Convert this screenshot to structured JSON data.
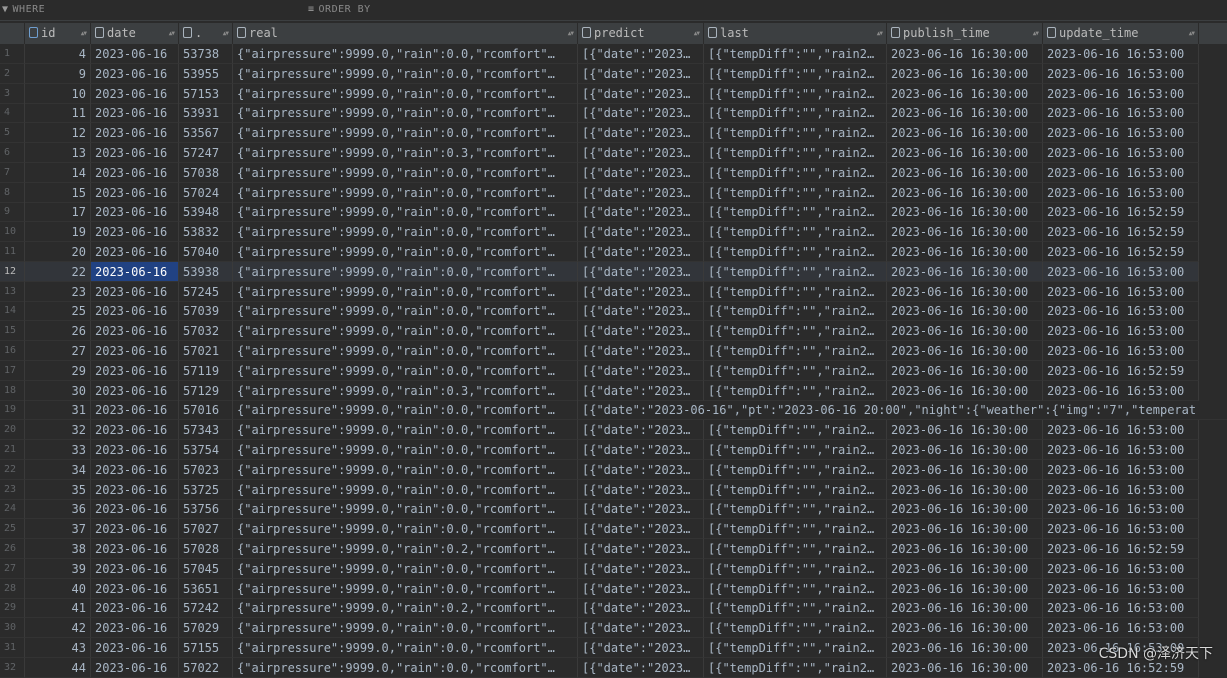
{
  "filter": {
    "where_label": "WHERE",
    "order_label": "ORDER BY"
  },
  "columns": [
    {
      "label": "id"
    },
    {
      "label": "date"
    },
    {
      "label": "."
    },
    {
      "label": "real"
    },
    {
      "label": "predict"
    },
    {
      "label": "last"
    },
    {
      "label": "publish_time"
    },
    {
      "label": "update_time"
    }
  ],
  "rows": [
    {
      "n": "1",
      "id": "4",
      "date": "2023-06-16",
      "code": "53738",
      "real": "{\"airpressure\":9999.0,\"rain\":0.0,\"rcomfort\"…",
      "predict": "[{\"date\":\"2023…",
      "last": "[{\"tempDiff\":\"\",\"rain2…",
      "pub": "2023-06-16 16:30:00",
      "upd": "2023-06-16 16:53:00"
    },
    {
      "n": "2",
      "id": "9",
      "date": "2023-06-16",
      "code": "53955",
      "real": "{\"airpressure\":9999.0,\"rain\":0.0,\"rcomfort\"…",
      "predict": "[{\"date\":\"2023…",
      "last": "[{\"tempDiff\":\"\",\"rain2…",
      "pub": "2023-06-16 16:30:00",
      "upd": "2023-06-16 16:53:00"
    },
    {
      "n": "3",
      "id": "10",
      "date": "2023-06-16",
      "code": "57153",
      "real": "{\"airpressure\":9999.0,\"rain\":0.0,\"rcomfort\"…",
      "predict": "[{\"date\":\"2023…",
      "last": "[{\"tempDiff\":\"\",\"rain2…",
      "pub": "2023-06-16 16:30:00",
      "upd": "2023-06-16 16:53:00"
    },
    {
      "n": "4",
      "id": "11",
      "date": "2023-06-16",
      "code": "53931",
      "real": "{\"airpressure\":9999.0,\"rain\":0.0,\"rcomfort\"…",
      "predict": "[{\"date\":\"2023…",
      "last": "[{\"tempDiff\":\"\",\"rain2…",
      "pub": "2023-06-16 16:30:00",
      "upd": "2023-06-16 16:53:00"
    },
    {
      "n": "5",
      "id": "12",
      "date": "2023-06-16",
      "code": "53567",
      "real": "{\"airpressure\":9999.0,\"rain\":0.0,\"rcomfort\"…",
      "predict": "[{\"date\":\"2023…",
      "last": "[{\"tempDiff\":\"\",\"rain2…",
      "pub": "2023-06-16 16:30:00",
      "upd": "2023-06-16 16:53:00"
    },
    {
      "n": "6",
      "id": "13",
      "date": "2023-06-16",
      "code": "57247",
      "real": "{\"airpressure\":9999.0,\"rain\":0.3,\"rcomfort\"…",
      "predict": "[{\"date\":\"2023…",
      "last": "[{\"tempDiff\":\"\",\"rain2…",
      "pub": "2023-06-16 16:30:00",
      "upd": "2023-06-16 16:53:00"
    },
    {
      "n": "7",
      "id": "14",
      "date": "2023-06-16",
      "code": "57038",
      "real": "{\"airpressure\":9999.0,\"rain\":0.0,\"rcomfort\"…",
      "predict": "[{\"date\":\"2023…",
      "last": "[{\"tempDiff\":\"\",\"rain2…",
      "pub": "2023-06-16 16:30:00",
      "upd": "2023-06-16 16:53:00"
    },
    {
      "n": "8",
      "id": "15",
      "date": "2023-06-16",
      "code": "57024",
      "real": "{\"airpressure\":9999.0,\"rain\":0.0,\"rcomfort\"…",
      "predict": "[{\"date\":\"2023…",
      "last": "[{\"tempDiff\":\"\",\"rain2…",
      "pub": "2023-06-16 16:30:00",
      "upd": "2023-06-16 16:53:00"
    },
    {
      "n": "9",
      "id": "17",
      "date": "2023-06-16",
      "code": "53948",
      "real": "{\"airpressure\":9999.0,\"rain\":0.0,\"rcomfort\"…",
      "predict": "[{\"date\":\"2023…",
      "last": "[{\"tempDiff\":\"\",\"rain2…",
      "pub": "2023-06-16 16:30:00",
      "upd": "2023-06-16 16:52:59"
    },
    {
      "n": "10",
      "id": "19",
      "date": "2023-06-16",
      "code": "53832",
      "real": "{\"airpressure\":9999.0,\"rain\":0.0,\"rcomfort\"…",
      "predict": "[{\"date\":\"2023…",
      "last": "[{\"tempDiff\":\"\",\"rain2…",
      "pub": "2023-06-16 16:30:00",
      "upd": "2023-06-16 16:52:59"
    },
    {
      "n": "11",
      "id": "20",
      "date": "2023-06-16",
      "code": "57040",
      "real": "{\"airpressure\":9999.0,\"rain\":0.0,\"rcomfort\"…",
      "predict": "[{\"date\":\"2023…",
      "last": "[{\"tempDiff\":\"\",\"rain2…",
      "pub": "2023-06-16 16:30:00",
      "upd": "2023-06-16 16:52:59"
    },
    {
      "n": "12",
      "id": "22",
      "date": "2023-06-16",
      "code": "53938",
      "real": "{\"airpressure\":9999.0,\"rain\":0.0,\"rcomfort\"…",
      "predict": "[{\"date\":\"2023…",
      "last": "[{\"tempDiff\":\"\",\"rain2…",
      "pub": "2023-06-16 16:30:00",
      "upd": "2023-06-16 16:53:00"
    },
    {
      "n": "13",
      "id": "23",
      "date": "2023-06-16",
      "code": "57245",
      "real": "{\"airpressure\":9999.0,\"rain\":0.0,\"rcomfort\"…",
      "predict": "[{\"date\":\"2023…",
      "last": "[{\"tempDiff\":\"\",\"rain2…",
      "pub": "2023-06-16 16:30:00",
      "upd": "2023-06-16 16:53:00"
    },
    {
      "n": "14",
      "id": "25",
      "date": "2023-06-16",
      "code": "57039",
      "real": "{\"airpressure\":9999.0,\"rain\":0.0,\"rcomfort\"…",
      "predict": "[{\"date\":\"2023…",
      "last": "[{\"tempDiff\":\"\",\"rain2…",
      "pub": "2023-06-16 16:30:00",
      "upd": "2023-06-16 16:53:00"
    },
    {
      "n": "15",
      "id": "26",
      "date": "2023-06-16",
      "code": "57032",
      "real": "{\"airpressure\":9999.0,\"rain\":0.0,\"rcomfort\"…",
      "predict": "[{\"date\":\"2023…",
      "last": "[{\"tempDiff\":\"\",\"rain2…",
      "pub": "2023-06-16 16:30:00",
      "upd": "2023-06-16 16:53:00"
    },
    {
      "n": "16",
      "id": "27",
      "date": "2023-06-16",
      "code": "57021",
      "real": "{\"airpressure\":9999.0,\"rain\":0.0,\"rcomfort\"…",
      "predict": "[{\"date\":\"2023…",
      "last": "[{\"tempDiff\":\"\",\"rain2…",
      "pub": "2023-06-16 16:30:00",
      "upd": "2023-06-16 16:53:00"
    },
    {
      "n": "17",
      "id": "29",
      "date": "2023-06-16",
      "code": "57119",
      "real": "{\"airpressure\":9999.0,\"rain\":0.0,\"rcomfort\"…",
      "predict": "[{\"date\":\"2023…",
      "last": "[{\"tempDiff\":\"\",\"rain2…",
      "pub": "2023-06-16 16:30:00",
      "upd": "2023-06-16 16:52:59"
    },
    {
      "n": "18",
      "id": "30",
      "date": "2023-06-16",
      "code": "57129",
      "real": "{\"airpressure\":9999.0,\"rain\":0.3,\"rcomfort\"…",
      "predict": "[{\"date\":\"2023…",
      "last": "[{\"tempDiff\":\"\",\"rain2…",
      "pub": "2023-06-16 16:30:00",
      "upd": "2023-06-16 16:53:00"
    },
    {
      "n": "19",
      "id": "31",
      "date": "2023-06-16",
      "code": "57016",
      "real": "{\"airpressure\":9999.0,\"rain\":0.0,\"rcomfort\"…",
      "predict": "[{\"date\":\"2023-06-16\",\"pt\":\"2023-06-16 20:00\",\"night\":{\"weather\":{\"img\":\"7\",\"temperat",
      "last": "",
      "pub": "",
      "upd": "",
      "overflow": true
    },
    {
      "n": "20",
      "id": "32",
      "date": "2023-06-16",
      "code": "57343",
      "real": "{\"airpressure\":9999.0,\"rain\":0.0,\"rcomfort\"…",
      "predict": "[{\"date\":\"2023…",
      "last": "[{\"tempDiff\":\"\",\"rain2…",
      "pub": "2023-06-16 16:30:00",
      "upd": "2023-06-16 16:53:00"
    },
    {
      "n": "21",
      "id": "33",
      "date": "2023-06-16",
      "code": "53754",
      "real": "{\"airpressure\":9999.0,\"rain\":0.0,\"rcomfort\"…",
      "predict": "[{\"date\":\"2023…",
      "last": "[{\"tempDiff\":\"\",\"rain2…",
      "pub": "2023-06-16 16:30:00",
      "upd": "2023-06-16 16:53:00"
    },
    {
      "n": "22",
      "id": "34",
      "date": "2023-06-16",
      "code": "57023",
      "real": "{\"airpressure\":9999.0,\"rain\":0.0,\"rcomfort\"…",
      "predict": "[{\"date\":\"2023…",
      "last": "[{\"tempDiff\":\"\",\"rain2…",
      "pub": "2023-06-16 16:30:00",
      "upd": "2023-06-16 16:53:00"
    },
    {
      "n": "23",
      "id": "35",
      "date": "2023-06-16",
      "code": "53725",
      "real": "{\"airpressure\":9999.0,\"rain\":0.0,\"rcomfort\"…",
      "predict": "[{\"date\":\"2023…",
      "last": "[{\"tempDiff\":\"\",\"rain2…",
      "pub": "2023-06-16 16:30:00",
      "upd": "2023-06-16 16:53:00"
    },
    {
      "n": "24",
      "id": "36",
      "date": "2023-06-16",
      "code": "53756",
      "real": "{\"airpressure\":9999.0,\"rain\":0.0,\"rcomfort\"…",
      "predict": "[{\"date\":\"2023…",
      "last": "[{\"tempDiff\":\"\",\"rain2…",
      "pub": "2023-06-16 16:30:00",
      "upd": "2023-06-16 16:53:00"
    },
    {
      "n": "25",
      "id": "37",
      "date": "2023-06-16",
      "code": "57027",
      "real": "{\"airpressure\":9999.0,\"rain\":0.0,\"rcomfort\"…",
      "predict": "[{\"date\":\"2023…",
      "last": "[{\"tempDiff\":\"\",\"rain2…",
      "pub": "2023-06-16 16:30:00",
      "upd": "2023-06-16 16:53:00"
    },
    {
      "n": "26",
      "id": "38",
      "date": "2023-06-16",
      "code": "57028",
      "real": "{\"airpressure\":9999.0,\"rain\":0.2,\"rcomfort\"…",
      "predict": "[{\"date\":\"2023…",
      "last": "[{\"tempDiff\":\"\",\"rain2…",
      "pub": "2023-06-16 16:30:00",
      "upd": "2023-06-16 16:52:59"
    },
    {
      "n": "27",
      "id": "39",
      "date": "2023-06-16",
      "code": "57045",
      "real": "{\"airpressure\":9999.0,\"rain\":0.0,\"rcomfort\"…",
      "predict": "[{\"date\":\"2023…",
      "last": "[{\"tempDiff\":\"\",\"rain2…",
      "pub": "2023-06-16 16:30:00",
      "upd": "2023-06-16 16:53:00"
    },
    {
      "n": "28",
      "id": "40",
      "date": "2023-06-16",
      "code": "53651",
      "real": "{\"airpressure\":9999.0,\"rain\":0.0,\"rcomfort\"…",
      "predict": "[{\"date\":\"2023…",
      "last": "[{\"tempDiff\":\"\",\"rain2…",
      "pub": "2023-06-16 16:30:00",
      "upd": "2023-06-16 16:53:00"
    },
    {
      "n": "29",
      "id": "41",
      "date": "2023-06-16",
      "code": "57242",
      "real": "{\"airpressure\":9999.0,\"rain\":0.2,\"rcomfort\"…",
      "predict": "[{\"date\":\"2023…",
      "last": "[{\"tempDiff\":\"\",\"rain2…",
      "pub": "2023-06-16 16:30:00",
      "upd": "2023-06-16 16:53:00"
    },
    {
      "n": "30",
      "id": "42",
      "date": "2023-06-16",
      "code": "57029",
      "real": "{\"airpressure\":9999.0,\"rain\":0.0,\"rcomfort\"…",
      "predict": "[{\"date\":\"2023…",
      "last": "[{\"tempDiff\":\"\",\"rain2…",
      "pub": "2023-06-16 16:30:00",
      "upd": "2023-06-16 16:53:00"
    },
    {
      "n": "31",
      "id": "43",
      "date": "2023-06-16",
      "code": "57155",
      "real": "{\"airpressure\":9999.0,\"rain\":0.0,\"rcomfort\"…",
      "predict": "[{\"date\":\"2023…",
      "last": "[{\"tempDiff\":\"\",\"rain2…",
      "pub": "2023-06-16 16:30:00",
      "upd": "2023-06-16 16:53:00"
    },
    {
      "n": "32",
      "id": "44",
      "date": "2023-06-16",
      "code": "57022",
      "real": "{\"airpressure\":9999.0,\"rain\":0.0,\"rcomfort\"…",
      "predict": "[{\"date\":\"2023…",
      "last": "[{\"tempDiff\":\"\",\"rain2…",
      "pub": "2023-06-16 16:30:00",
      "upd": "2023-06-16 16:52:59"
    }
  ],
  "selected_row": 11,
  "watermark": "CSDN @泽济天下",
  "colors": {
    "background": "#2b2b2b",
    "header": "#3c3f41",
    "selection": "#214283",
    "text": "#a9b7c6"
  }
}
